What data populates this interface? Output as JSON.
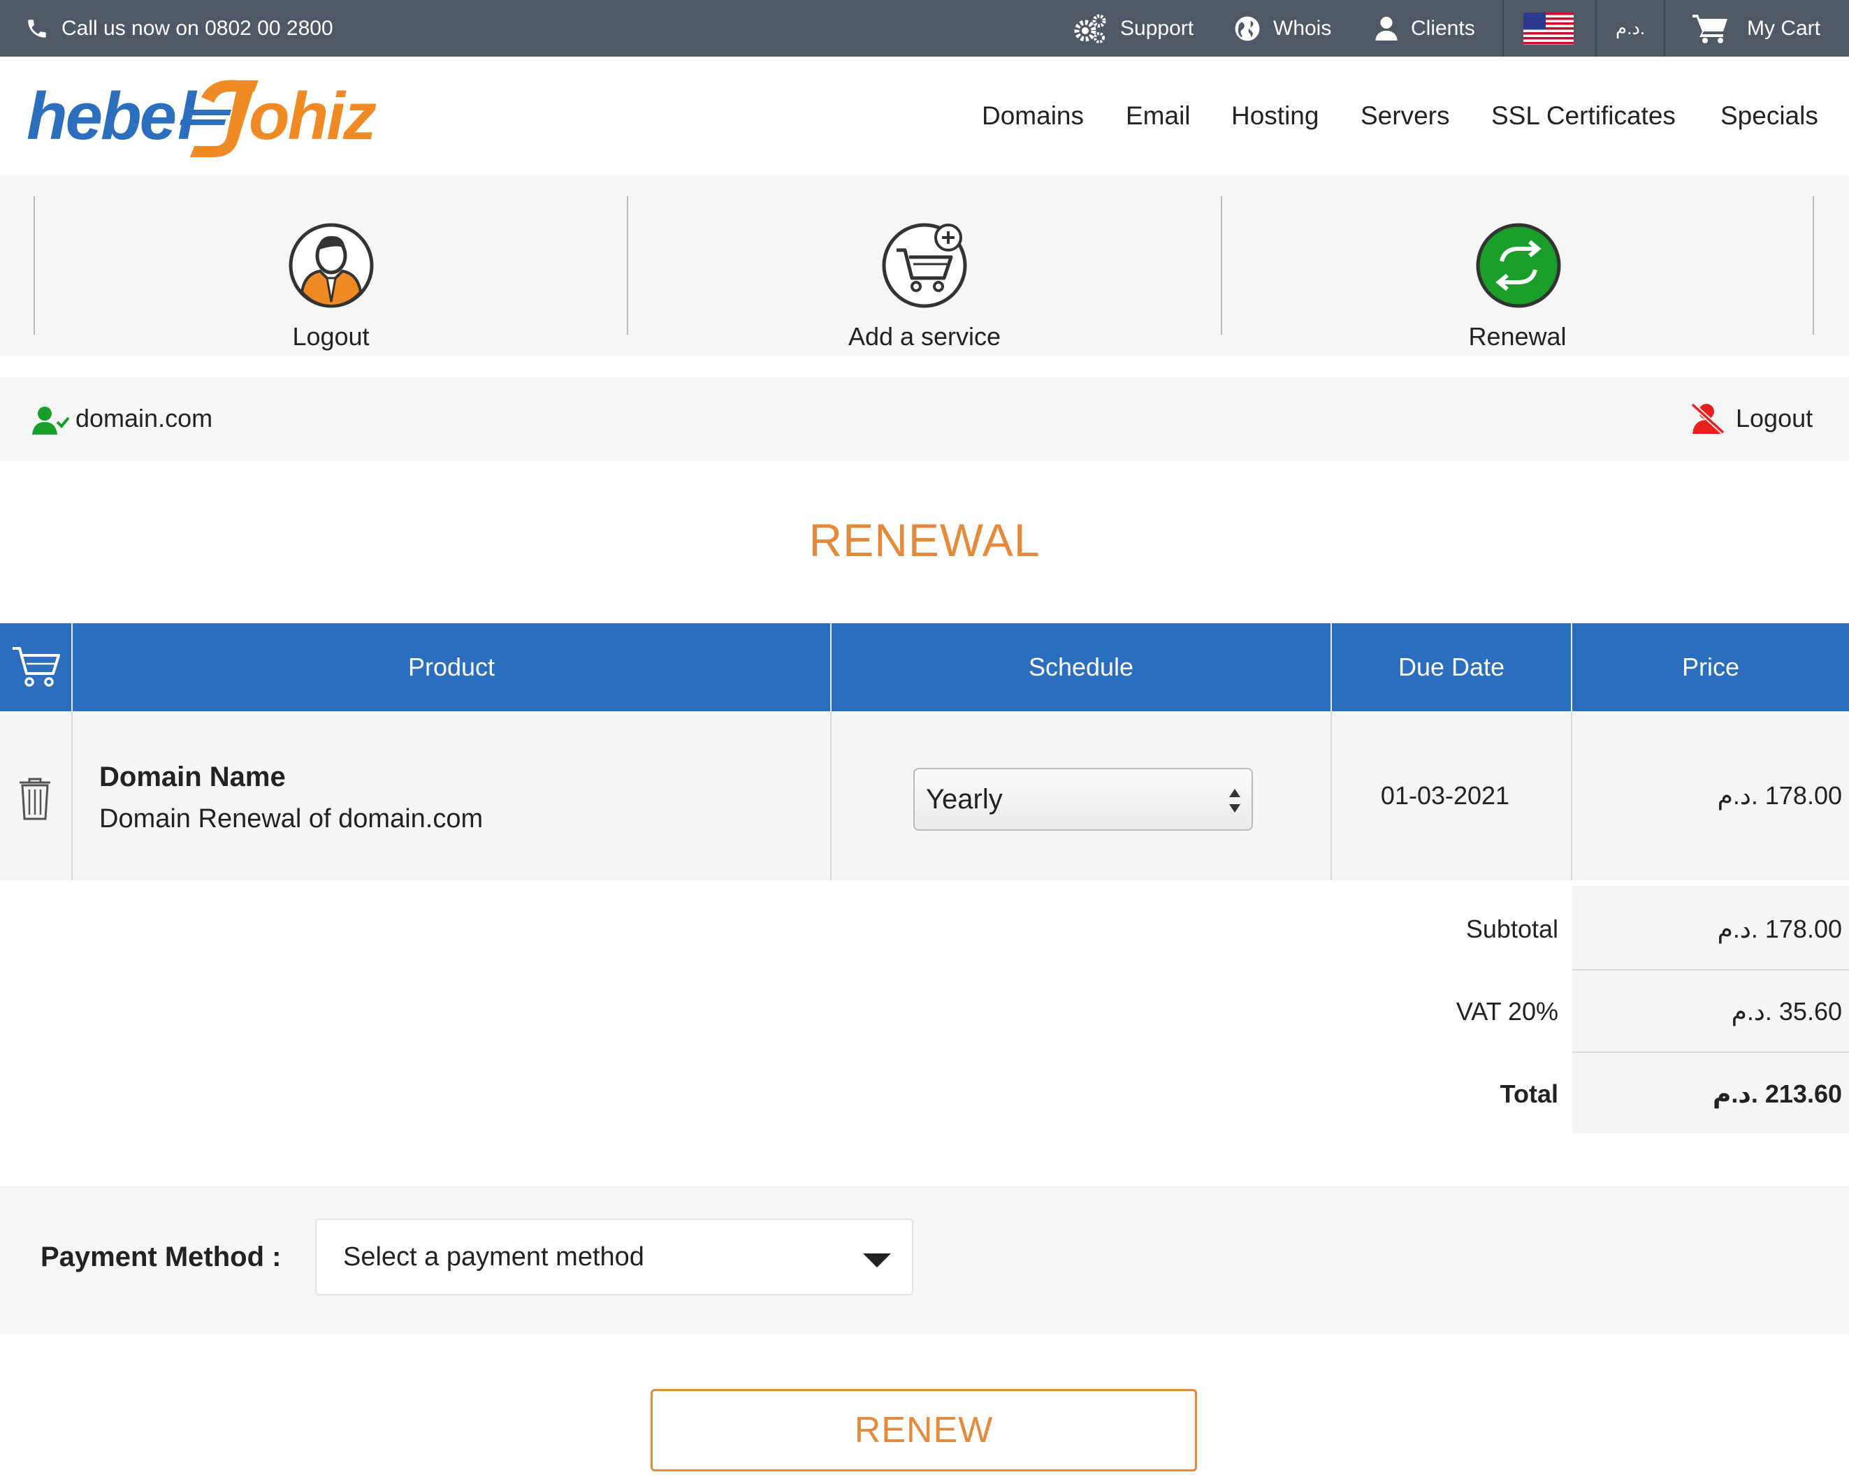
{
  "topbar": {
    "phone_text": "Call us now on 0802 00 2800",
    "support": "Support",
    "whois": "Whois",
    "clients": "Clients",
    "currency": "د.م.",
    "cart": "My Cart"
  },
  "brand": {
    "part1": "hebe",
    "part2": "ohiz",
    "color_blue": "#2a6ebd",
    "color_orange": "#f08a24"
  },
  "nav": [
    "Domains",
    "Email",
    "Hosting",
    "Servers",
    "SSL Certificates",
    "Specials"
  ],
  "panels": {
    "logout": "Logout",
    "add_service": "Add a service",
    "renewal": "Renewal"
  },
  "userbar": {
    "domain": "domain.com",
    "logout": "Logout"
  },
  "page_title": "RENEWAL",
  "table": {
    "headers": {
      "product": "Product",
      "schedule": "Schedule",
      "due_date": "Due Date",
      "price": "Price"
    },
    "row": {
      "product_title": "Domain Name",
      "product_desc": "Domain Renewal of domain.com",
      "schedule": "Yearly",
      "due_date": "01-03-2021",
      "price": "178.00 .د.م"
    }
  },
  "totals": {
    "subtotal_label": "Subtotal",
    "subtotal": "178.00 .د.م",
    "vat_label": "VAT 20%",
    "vat": "35.60 .د.م",
    "total_label": "Total",
    "total": "213.60 .د.م"
  },
  "payment": {
    "label": "Payment Method :",
    "placeholder": "Select a payment method"
  },
  "renew_button": "RENEW",
  "colors": {
    "topbar": "#4f5864",
    "accent_orange": "#e58a3b",
    "table_header": "#2a6ebd",
    "renewal_green": "#1a9e2a",
    "logout_red": "#e8201e"
  }
}
